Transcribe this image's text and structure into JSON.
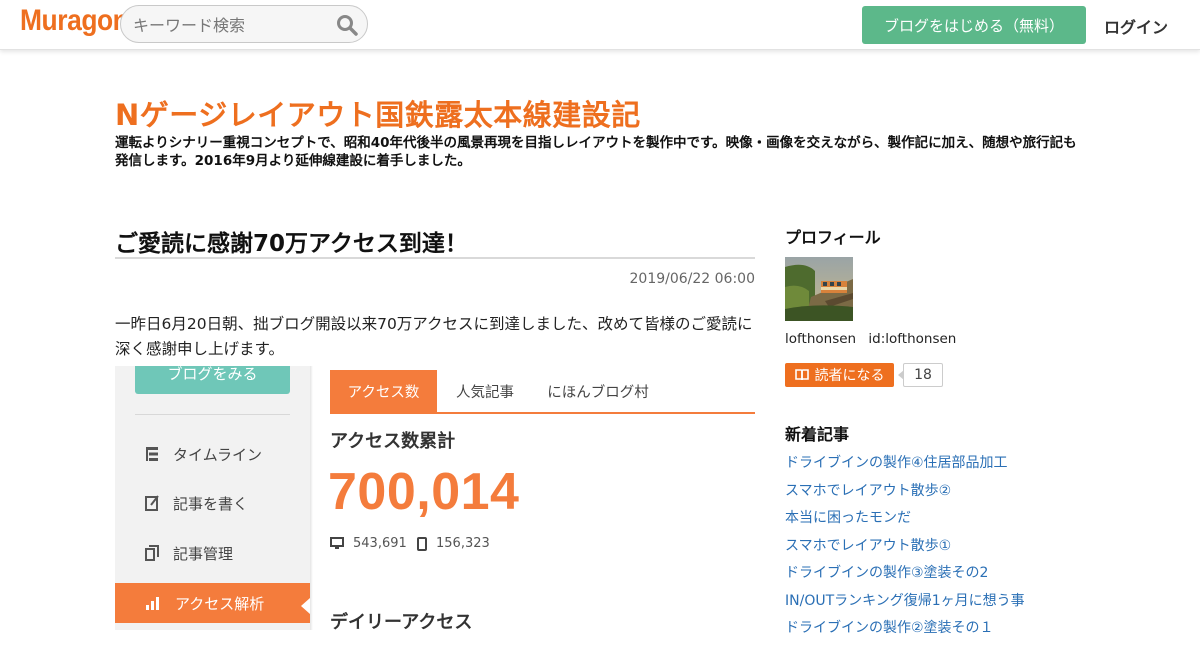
{
  "header": {
    "logo": "Muragon",
    "search_placeholder": "キーワード検索",
    "start_label": "ブログをはじめる（無料）",
    "login_label": "ログイン"
  },
  "blog": {
    "title": "Nゲージレイアウト国鉄露太本線建設記",
    "description": "運転よりシナリー重視コンセプトで、昭和40年代後半の風景再現を目指しレイアウトを製作中です。映像・画像を交えながら、製作記に加え、随想や旅行記も発信します。2016年9月より延伸線建設に着手しました。"
  },
  "article": {
    "title": "ご愛読に感謝70万アクセス到達！",
    "date": "2019/06/22 06:00",
    "body": "一昨日6月20日朝、拙ブログ開設以来70万アクセスに到達しました、改めて皆様のご愛読に深く感謝申し上げます。"
  },
  "screenshot": {
    "view_blog_label": "ブログをみる",
    "nav": [
      "タイムライン",
      "記事を書く",
      "記事管理",
      "アクセス解析"
    ],
    "tabs": [
      "アクセス数",
      "人気記事",
      "にほんブログ村"
    ],
    "access_heading": "アクセス数累計",
    "total": "700,014",
    "pc_count": "543,691",
    "mobile_count": "156,323",
    "daily_heading": "デイリーアクセス"
  },
  "sidebar": {
    "profile_title": "プロフィール",
    "username": "lofthonsen",
    "user_id": "id:lofthonsen",
    "follow_label": "読者になる",
    "follower_count": "18",
    "recent_title": "新着記事",
    "recent": [
      "ドライブインの製作④住居部品加工",
      "スマホでレイアウト散歩②",
      "本当に困ったモンだ",
      "スマホでレイアウト散歩①",
      "ドライブインの製作③塗装その2",
      "IN/OUTランキング復帰1ヶ月に想う事",
      "ドライブインの製作②塗装その１"
    ]
  },
  "colors": {
    "brand": "#ee6f1f",
    "start_button": "#5cb88a",
    "link": "#2a6fb5",
    "accent_orange": "#f47c3c",
    "view_button": "#6fc7b8"
  }
}
